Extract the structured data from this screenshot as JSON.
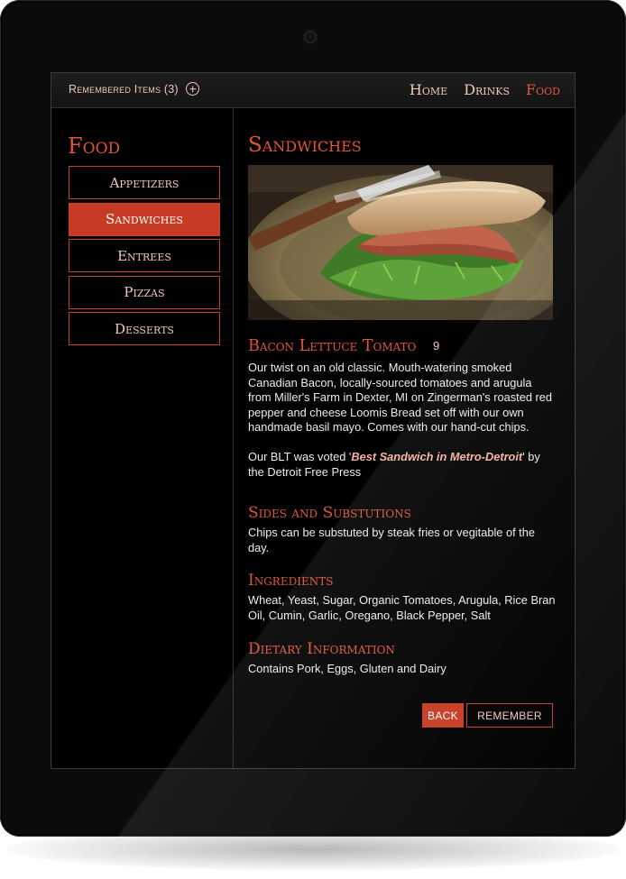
{
  "header": {
    "remembered_label": "Remembered Items (3)",
    "add_icon": "plus-circle-icon",
    "nav": [
      {
        "label": "Home",
        "active": false
      },
      {
        "label": "Drinks",
        "active": false
      },
      {
        "label": "Food",
        "active": true
      }
    ]
  },
  "sidebar": {
    "title": "Food",
    "categories": [
      {
        "label": "Appetizers",
        "active": false
      },
      {
        "label": "Sandwiches",
        "active": true
      },
      {
        "label": "Entrees",
        "active": false
      },
      {
        "label": "Pizzas",
        "active": false
      },
      {
        "label": "Desserts",
        "active": false
      }
    ]
  },
  "main": {
    "title": "Sandwiches",
    "image_icon": "sandwich-photo",
    "dish": {
      "name": "Bacon Lettuce Tomato",
      "price": "9",
      "description": "Our twist on an old classic. Mouth-watering smoked Canadian Bacon, locally-sourced tomatoes and arugula from Miller's Farm in Dexter, MI on Zingerman's roasted red pepper and cheese Loomis Bread set off with our own handmade basil mayo. Comes with our hand-cut chips.",
      "voted_prefix": "Our BLT was voted '",
      "voted_award": "Best Sandwich in Metro-Detroit",
      "voted_suffix": "' by the Detroit Free Press"
    },
    "sides": {
      "title": "Sides and Substutions",
      "text": "Chips can be substuted by steak fries or vegitable of the day."
    },
    "ingredients": {
      "title": "Ingredients",
      "text": "Wheat, Yeast, Sugar, Organic Tomatoes, Arugula, Rice Bran Oil, Cumin, Garlic, Oregano, Black Pepper, Salt"
    },
    "dietary": {
      "title": "Dietary Information",
      "text": "Contains Pork, Eggs, Gluten and Dairy"
    },
    "buttons": {
      "back": "BACK",
      "remember": "REMEMBER"
    }
  },
  "colors": {
    "accent": "#e0553a",
    "accent_fill": "#c73a23",
    "text_light": "#f0c9ba",
    "background": "#000000"
  }
}
